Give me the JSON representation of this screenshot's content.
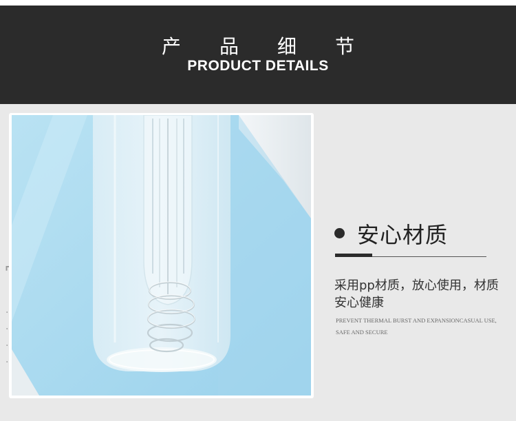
{
  "header": {
    "title_cn": "产品细节",
    "title_en": "PRODUCT DETAILS"
  },
  "feature": {
    "title": "安心材质",
    "description": "采用pp材质，放心使用，材质安心健康",
    "english_note": "PREVENT THERMAL BURST AND EXPANSIONCASUAL USE, SAFE AND SECURE"
  },
  "photo": {
    "subject": "frosted plastic shaker bottle with wire whisk ball",
    "background_color": "#a9d9ef"
  },
  "colors": {
    "header_bg": "#2b2b2b",
    "content_bg": "#e9e9e9",
    "accent_dark": "#2b2b2b"
  }
}
